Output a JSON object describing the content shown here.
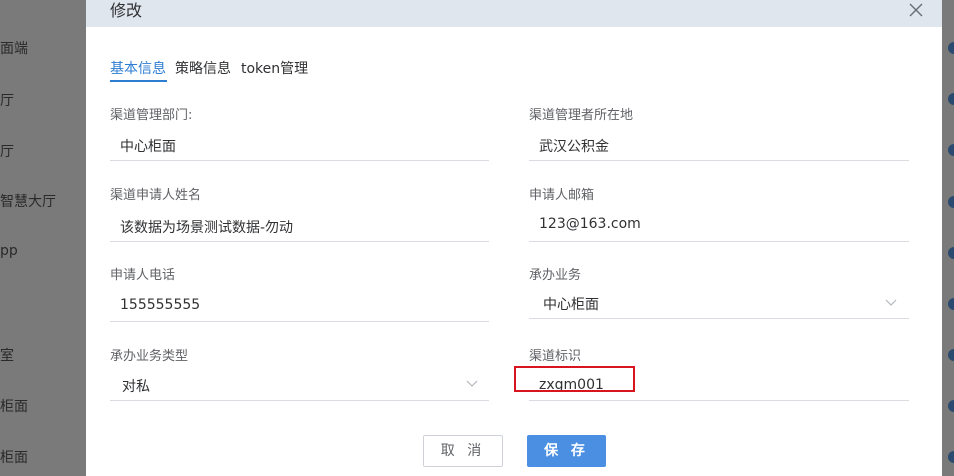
{
  "background": {
    "left_items": [
      "面端",
      "厅",
      "厅",
      "智慧大厅",
      "pp",
      "室",
      "柜面",
      "柜面"
    ]
  },
  "dialog": {
    "title": "修改",
    "tabs": [
      "基本信息",
      "策略信息",
      "token管理"
    ],
    "fields": {
      "dept": {
        "label": "渠道管理部门:",
        "value": "中心柜面"
      },
      "location": {
        "label": "渠道管理者所在地",
        "value": "武汉公积金"
      },
      "applicant_name": {
        "label": "渠道申请人姓名",
        "value": "该数据为场景测试数据-勿动"
      },
      "email": {
        "label": "申请人邮箱",
        "value": "123@163.com"
      },
      "phone": {
        "label": "申请人电话",
        "value": "155555555"
      },
      "business": {
        "label": "承办业务",
        "value": "中心柜面"
      },
      "business_type": {
        "label": "承办业务类型",
        "value": "对私"
      },
      "channel_id": {
        "label": "渠道标识",
        "value": "zxgm001"
      }
    },
    "buttons": {
      "cancel": "取 消",
      "save": "保 存"
    },
    "colors": {
      "accent": "#2d7dd2",
      "save_button": "#4a8fe2",
      "highlight": "#d8141f"
    }
  }
}
